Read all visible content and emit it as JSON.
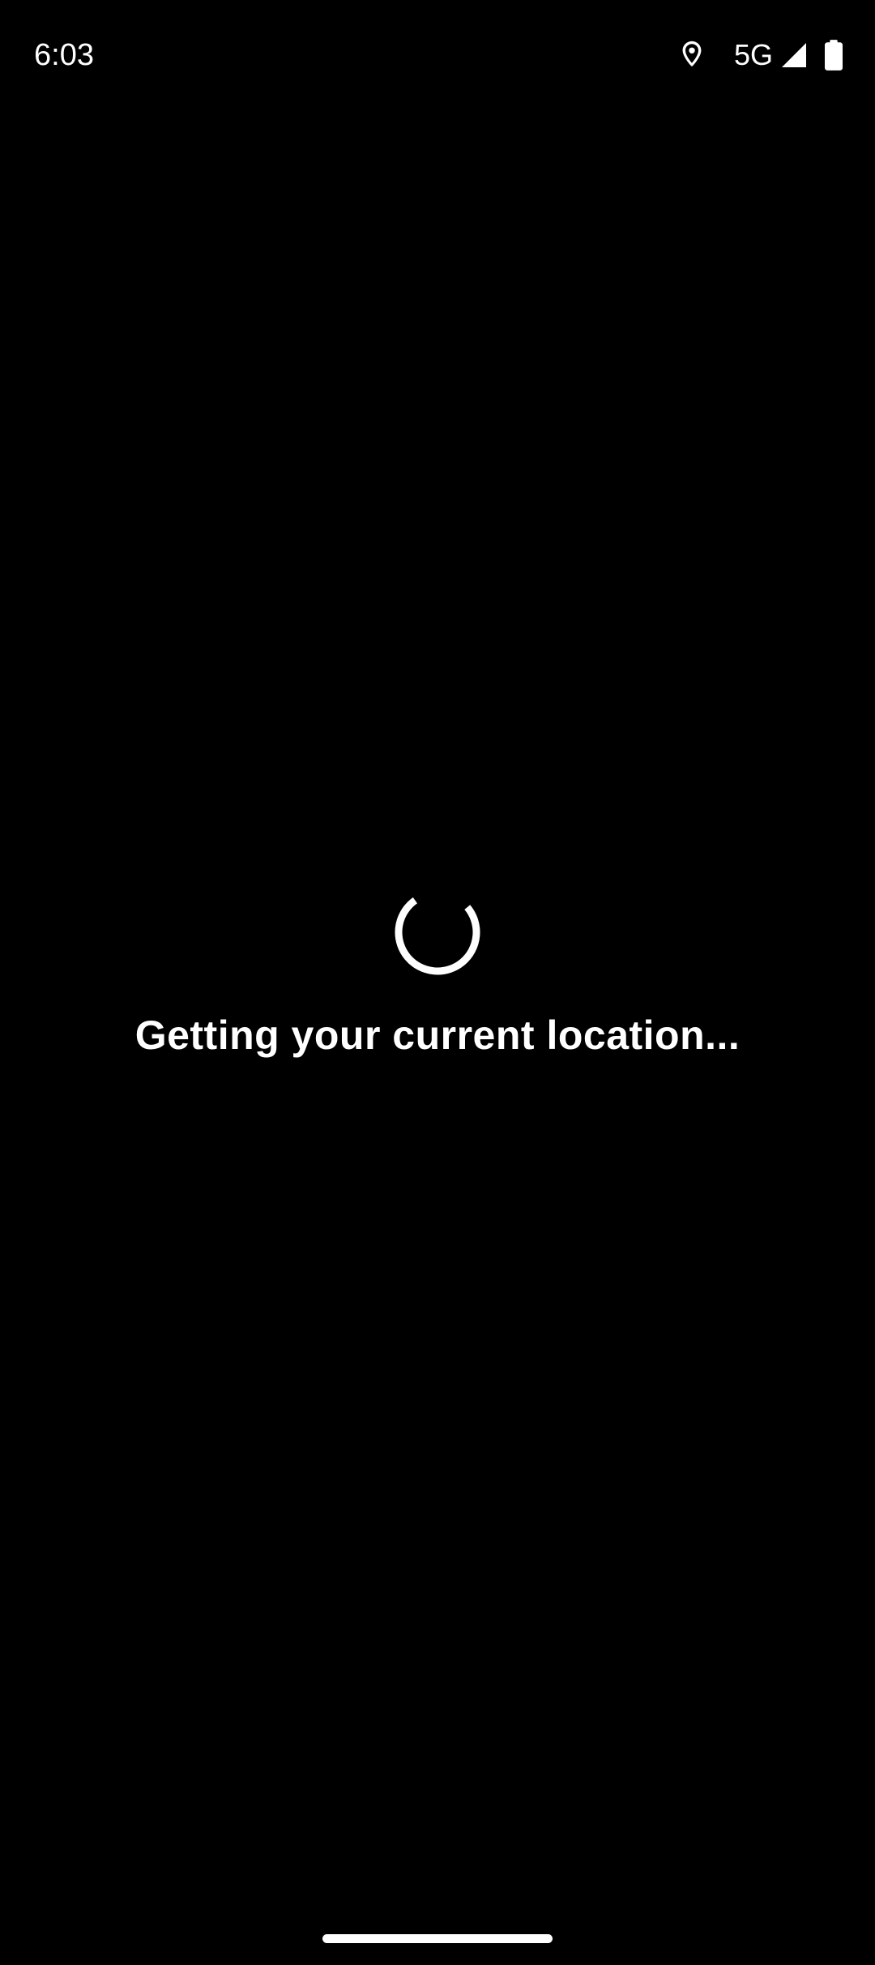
{
  "status_bar": {
    "time": "6:03",
    "network": "5G",
    "icons": {
      "location": "location-pin-icon",
      "signal": "cell-signal-icon",
      "battery": "battery-icon"
    }
  },
  "loading": {
    "message": "Getting your current location...",
    "spinner_icon": "loading-spinner-icon"
  },
  "colors": {
    "background": "#000000",
    "foreground": "#ffffff"
  }
}
